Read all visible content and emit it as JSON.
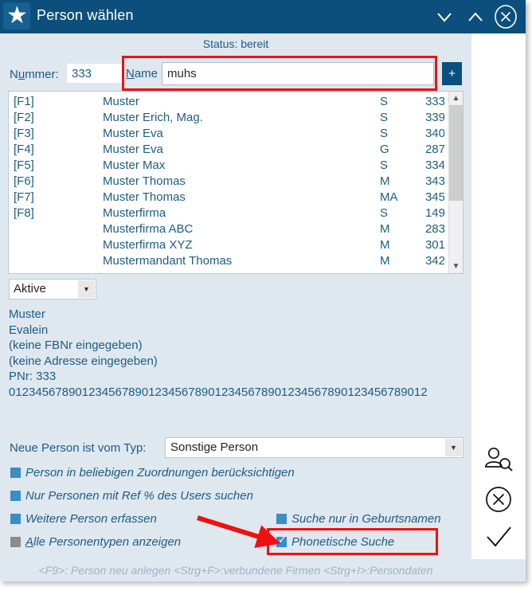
{
  "window": {
    "title": "Person wählen",
    "star_icon": "star-icon",
    "controls": [
      {
        "name": "minimize-button",
        "icon": "chevron-down-icon"
      },
      {
        "name": "maximize-button",
        "icon": "chevron-up-icon"
      },
      {
        "name": "close-button",
        "icon": "close-circle-icon"
      }
    ]
  },
  "status": {
    "text": "Status: bereit"
  },
  "search": {
    "nummer_label_pre": "N",
    "nummer_label_accel": "u",
    "nummer_label_post": "mmer:",
    "nummer_value": "333",
    "name_label_accel": "N",
    "name_label_post": "ame",
    "name_value": "muhs",
    "name_placeholder": "",
    "add_button_label": "+",
    "highlight_color": "#ee1111"
  },
  "list": {
    "columns": [
      "key",
      "name",
      "type",
      "number"
    ],
    "rows": [
      {
        "key": "[F1]",
        "name": "Muster",
        "type": "S",
        "number": "333"
      },
      {
        "key": "[F2]",
        "name": "Muster Erich, Mag.",
        "type": "S",
        "number": "339"
      },
      {
        "key": "[F3]",
        "name": "Muster Eva",
        "type": "S",
        "number": "340"
      },
      {
        "key": "[F4]",
        "name": "Muster Eva",
        "type": "G",
        "number": "287"
      },
      {
        "key": "[F5]",
        "name": "Muster Max",
        "type": "S",
        "number": "334"
      },
      {
        "key": "[F6]",
        "name": "Muster Thomas",
        "type": "M",
        "number": "343"
      },
      {
        "key": "[F7]",
        "name": "Muster Thomas",
        "type": "MA",
        "number": "345"
      },
      {
        "key": "[F8]",
        "name": "Musterfirma",
        "type": "S",
        "number": "149"
      },
      {
        "key": "",
        "name": "Musterfirma ABC",
        "type": "M",
        "number": "283"
      },
      {
        "key": "",
        "name": "Musterfirma XYZ",
        "type": "M",
        "number": "301"
      },
      {
        "key": "",
        "name": "Mustermandant Thomas",
        "type": "M",
        "number": "342"
      }
    ],
    "scroll_up_icon": "chevron-up-icon",
    "scroll_down_icon": "chevron-down-icon"
  },
  "state_filter": {
    "value": "Aktive",
    "arrow_icon": "chevron-down-icon"
  },
  "detail": {
    "lines": [
      "Muster",
      "Evalein",
      "(keine FBNr eingegeben)",
      "(keine Adresse eingegeben)",
      "PNr: 333",
      "012345678901234567890123456789012345678901234567890123456789012"
    ]
  },
  "new_person": {
    "label": "Neue Person ist vom Typ:",
    "value": "Sonstige Person",
    "arrow_icon": "chevron-down-icon"
  },
  "options": [
    {
      "name": "checkbox-person-beliebige-zuordnungen",
      "label": "Person in beliebigen Zuordnungen berücksichtigen",
      "checked": false,
      "disabled": false
    },
    {
      "name": "checkbox-nur-personen-ref",
      "label": "Nur Personen mit Ref % des Users suchen",
      "checked": false,
      "disabled": false
    },
    {
      "name": "checkbox-weitere-person-erfassen",
      "label": "Weitere Person erfassen",
      "checked": false,
      "disabled": false
    },
    {
      "name": "checkbox-alle-personentypen",
      "label": "Alle Personentypen  anzeigen",
      "label_accel": "A",
      "checked": false,
      "disabled": true
    },
    {
      "name": "checkbox-suche-geburtsnamen",
      "label": "Suche nur in Geburtsnamen",
      "checked": false,
      "disabled": false
    },
    {
      "name": "checkbox-phonetische-suche",
      "label": "Phonetische Suche",
      "checked": true,
      "disabled": false
    }
  ],
  "rail": [
    {
      "name": "person-search-icon",
      "label": "person-search"
    },
    {
      "name": "cancel-icon",
      "label": "cancel"
    },
    {
      "name": "confirm-icon",
      "label": "confirm"
    }
  ],
  "footer": {
    "text": "<F9>: Person neu anlegen <Strg+F>:verbundene Firmen <Strg+I>:Persondaten"
  },
  "colors": {
    "titlebar": "#0d4f7c",
    "window_bg": "#dfe7ef",
    "text_blue": "#1d5c86",
    "checkbox_blue": "#3a8ec4",
    "checkbox_gray": "#8c8c8c",
    "annotation_red": "#ee1111"
  }
}
